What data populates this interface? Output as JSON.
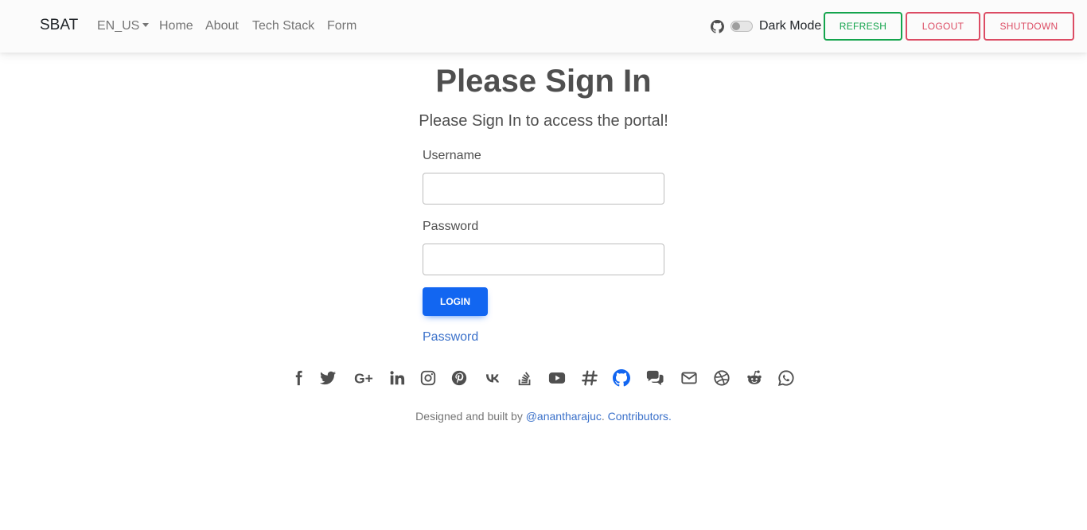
{
  "navbar": {
    "brand": "SBAT",
    "language": "EN_US",
    "links": [
      "Home",
      "About",
      "Tech Stack",
      "Form"
    ],
    "dark_mode_label": "Dark Mode",
    "dark_mode_on": false,
    "buttons": {
      "refresh": "REFRESH",
      "logout": "LOGOUT",
      "shutdown": "SHUTDOWN"
    }
  },
  "signin": {
    "title": "Please Sign In",
    "subtitle": "Please Sign In to access the portal!",
    "username_label": "Username",
    "username_value": "",
    "password_label": "Password",
    "password_value": "",
    "login_button": "LOGIN",
    "password_link": "Password"
  },
  "social_icons": [
    "facebook-icon",
    "twitter-icon",
    "google-plus-icon",
    "linkedin-icon",
    "instagram-icon",
    "pinterest-icon",
    "vk-icon",
    "stack-overflow-icon",
    "youtube-icon",
    "slack-icon",
    "github-icon",
    "comments-icon",
    "envelope-icon",
    "dribbble-icon",
    "reddit-icon",
    "whatsapp-icon"
  ],
  "footer": {
    "prefix": "Designed and built by ",
    "author": "@anantharajuc",
    "separator": ". ",
    "contributors": "Contributors",
    "suffix": "."
  },
  "colors": {
    "refresh": "#14a44d",
    "danger": "#dc4c64",
    "primary": "#1266f1",
    "link": "#3b71ca",
    "icon": "#4f4f4f"
  }
}
